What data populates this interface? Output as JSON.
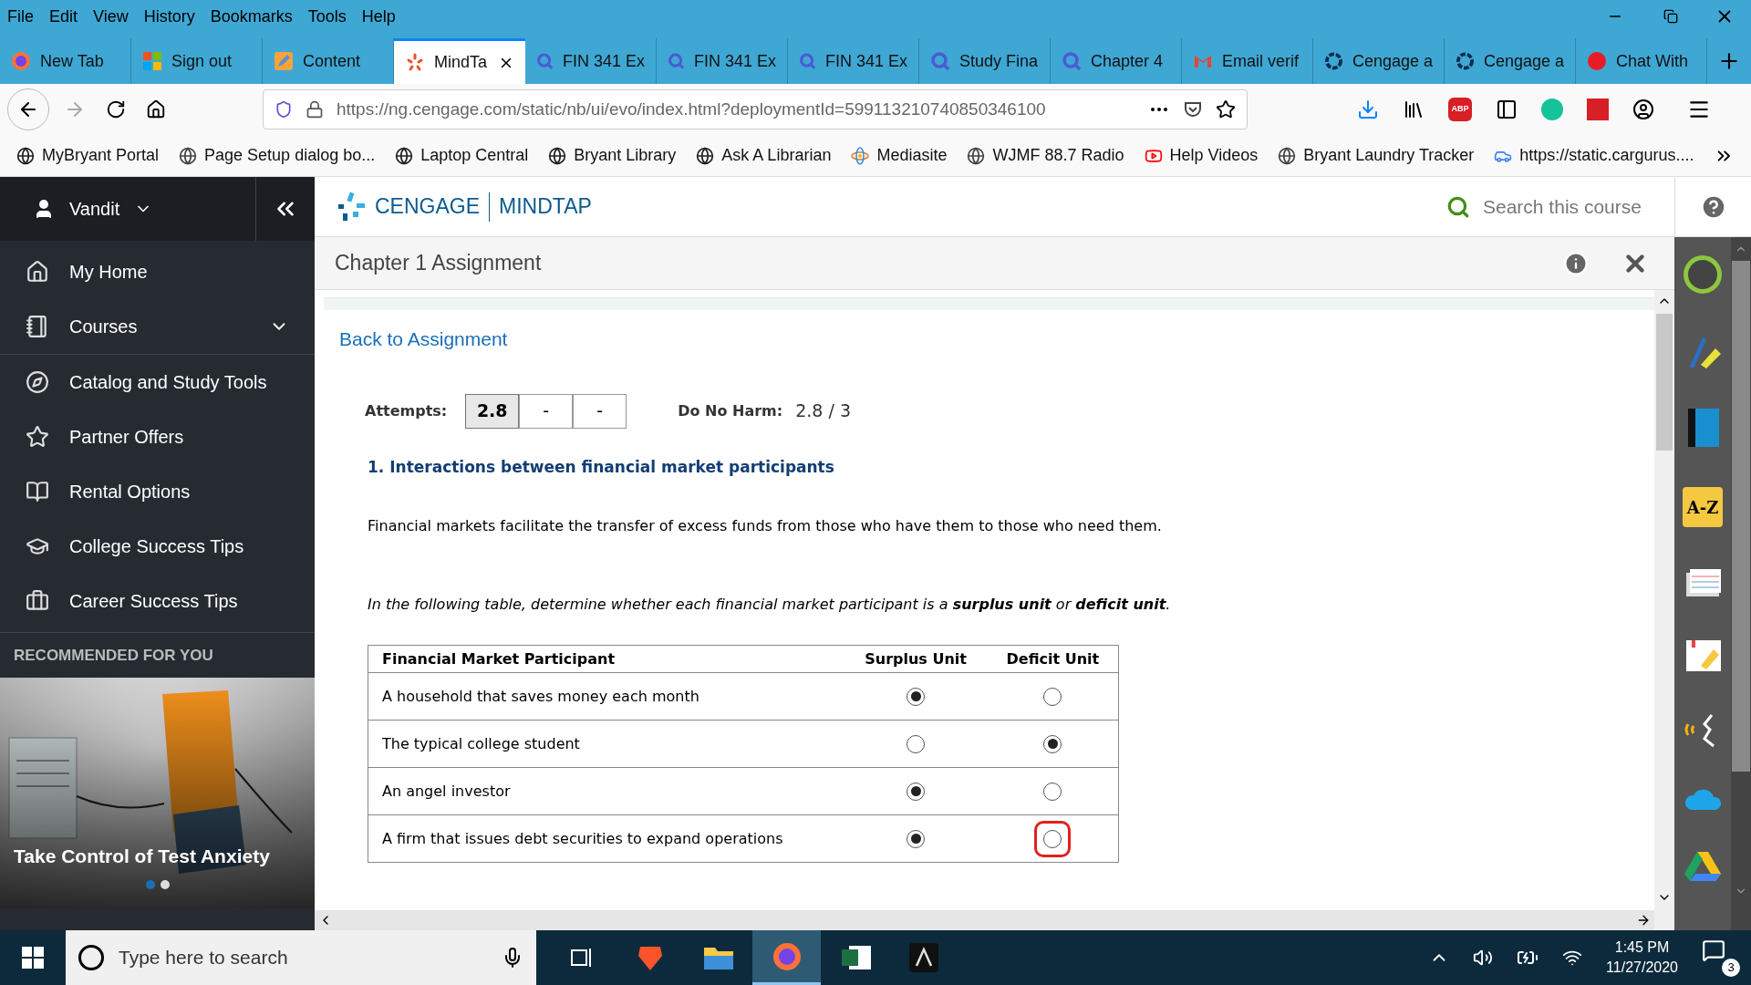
{
  "menu_bar": [
    "File",
    "Edit",
    "View",
    "History",
    "Bookmarks",
    "Tools",
    "Help"
  ],
  "tabs": [
    {
      "title": "New Tab",
      "selected": false
    },
    {
      "title": "Sign out",
      "selected": false
    },
    {
      "title": "Content",
      "selected": false
    },
    {
      "title": "MindTa",
      "selected": true
    },
    {
      "title": "FIN 341 Ex",
      "selected": false
    },
    {
      "title": "FIN 341 Ex",
      "selected": false
    },
    {
      "title": "FIN 341 Ex",
      "selected": false
    },
    {
      "title": "Study Fina",
      "selected": false
    },
    {
      "title": "Chapter 4",
      "selected": false
    },
    {
      "title": "Email verif",
      "selected": false
    },
    {
      "title": "Cengage a",
      "selected": false
    },
    {
      "title": "Cengage a",
      "selected": false
    },
    {
      "title": "Chat With",
      "selected": false
    }
  ],
  "address_bar": {
    "url": "https://ng.cengage.com/static/nb/ui/evo/index.html?deploymentId=599113210740850346100"
  },
  "adblock_label": "ABP",
  "bookmarks": [
    "MyBryant Portal",
    "Page Setup dialog bo...",
    "Laptop Central",
    "Bryant Library",
    "Ask A Librarian",
    "Mediasite",
    "WJMF 88.7 Radio",
    "Help Videos",
    "Bryant Laundry Tracker",
    "https://static.cargurus...."
  ],
  "sidebar": {
    "user": "Vandit",
    "items": [
      {
        "label": "My Home",
        "expandable": false
      },
      {
        "label": "Courses",
        "expandable": true
      },
      {
        "label": "Catalog and Study Tools",
        "expandable": false
      },
      {
        "label": "Partner Offers",
        "expandable": false
      },
      {
        "label": "Rental Options",
        "expandable": false
      },
      {
        "label": "College Success Tips",
        "expandable": false
      },
      {
        "label": "Career Success Tips",
        "expandable": false
      }
    ],
    "section_title": "RECOMMENDED FOR YOU",
    "promo": {
      "title": "Take Control of Test Anxiety",
      "dots": [
        {
          "selected": true
        },
        {
          "selected": false
        }
      ]
    }
  },
  "header": {
    "brand": "CENGAGE",
    "product": "MINDTAP",
    "search": {
      "placeholder": "Search this course"
    }
  },
  "activity": {
    "title": "Chapter 1 Assignment",
    "back_link": "Back to Assignment",
    "attempts_label": "Attempts:",
    "attempts": [
      {
        "value": "2.8",
        "selected": true
      },
      {
        "value": "-",
        "selected": false
      },
      {
        "value": "-",
        "selected": false
      }
    ],
    "score_label": "Do No Harm:",
    "score": "2.8 / 3",
    "question_title": "1. Interactions between financial market participants",
    "intro": "Financial markets facilitate the transfer of excess funds from those who have them to those who need them.",
    "instruction": "In the following table, determine whether each financial market participant is a **surplus unit** or **deficit unit**.",
    "table": {
      "columns": [
        "Financial Market Participant",
        "Surplus Unit",
        "Deficit Unit"
      ],
      "rows": [
        {
          "participant": "A household that saves money each month",
          "choices": [
            {
              "selected": true,
              "focused": false
            },
            {
              "selected": false,
              "focused": false
            }
          ]
        },
        {
          "participant": "The typical college student",
          "choices": [
            {
              "selected": false,
              "focused": false
            },
            {
              "selected": true,
              "focused": false
            }
          ]
        },
        {
          "participant": "An angel investor",
          "choices": [
            {
              "selected": true,
              "focused": false
            },
            {
              "selected": false,
              "focused": false
            }
          ]
        },
        {
          "participant": "A firm that issues debt securities to expand operations",
          "choices": [
            {
              "selected": true,
              "focused": false
            },
            {
              "selected": false,
              "focused": true
            }
          ]
        }
      ]
    }
  },
  "tool_panel": {
    "glossary_label": "A-Z"
  },
  "taskbar": {
    "search": {
      "placeholder": "Type here to search"
    },
    "apps": [
      {
        "selected": false
      },
      {
        "selected": false
      },
      {
        "selected": false
      },
      {
        "selected": true
      },
      {
        "selected": false
      },
      {
        "selected": false
      }
    ],
    "time": "1:45 PM",
    "date": "11/27/2020",
    "notifications": "3"
  }
}
